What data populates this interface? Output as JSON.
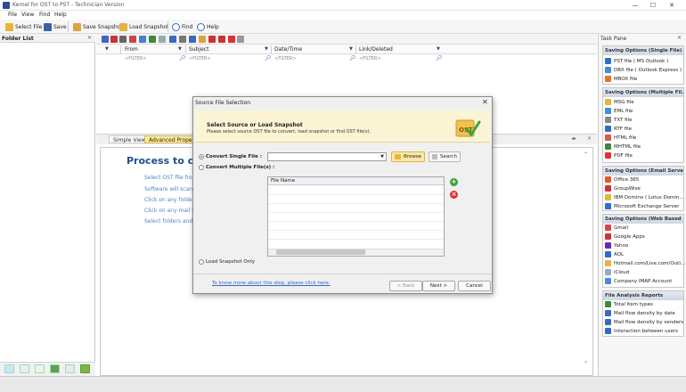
{
  "window": {
    "title": "Kernel for OST to PST - Technician Version",
    "min_label": "—",
    "max_label": "☐",
    "close_label": "✕"
  },
  "menu": [
    "File",
    "View",
    "Find",
    "Help"
  ],
  "toolbar": {
    "select_file": "Select File",
    "save": "Save",
    "save_snapshot": "Save Snapshot",
    "load_snapshot": "Load Snapshot",
    "find": "Find",
    "help": "Help"
  },
  "folder_list": {
    "title": "Folder List",
    "close": "✕"
  },
  "grid": {
    "columns": [
      "From",
      "Subject",
      "Date/Time",
      "Link/Deleted"
    ],
    "filter_text": "<FILTER>"
  },
  "tabs": {
    "simple": "Simple View",
    "advanced": "Advanced Properties"
  },
  "process": {
    "title": "Process to conv",
    "items": [
      "Select OST file from",
      "Software will scan a",
      "Click on any folder t",
      "Click on any mail to",
      "Select folders and cl"
    ]
  },
  "task_pane": {
    "title": "Task Pane",
    "close": "✕",
    "groups": [
      {
        "title": "Saving Options (Single File)",
        "items": [
          "PST file ( MS Outlook )",
          "DBX file ( Outlook Express )",
          "MBOX file"
        ]
      },
      {
        "title": "Saving Options (Multiple Fil...",
        "items": [
          "MSG file",
          "EML file",
          "TXT file",
          "RTF file",
          "HTML file",
          "MHTML file",
          "PDF file"
        ]
      },
      {
        "title": "Saving Options (Email Servers)",
        "items": [
          "Office 365",
          "GroupWise",
          "IBM Domino ( Lotus Domin...",
          "Microsoft Exchange Server"
        ]
      },
      {
        "title": "Saving Options (Web Based ...",
        "items": [
          "Gmail",
          "Google Apps",
          "Yahoo",
          "AOL",
          "Hotmail.com/Live.com/Outl...",
          "iCloud",
          "Company IMAP Account"
        ]
      },
      {
        "title": "File Analysis Reports",
        "items": [
          "Total item types",
          "Mail flow density by date",
          "Mail flow density by senders",
          "Interaction between users"
        ]
      }
    ]
  },
  "dialog": {
    "title": "Source File Selection",
    "close": "✕",
    "banner_title": "Select Source or Load Snapshot",
    "banner_sub": "Please select source OST file to convert, load snapshot or find OST file(s).",
    "opt_single": "Convert Single File :",
    "opt_multiple": "Convert Multiple File(s) :",
    "opt_snapshot": "Load Snapshot Only",
    "single_value": "",
    "browse": "Browse",
    "search": "Search",
    "list_header": "File Name",
    "link": "To know more about this step, please click here.",
    "back": "< Back",
    "next": "Next >",
    "cancel": "Cancel"
  },
  "colors": {
    "accent": "#1d4f8a",
    "banner": "#fbf5d6",
    "link": "#3467c2",
    "tab_active": "#fde99b"
  }
}
